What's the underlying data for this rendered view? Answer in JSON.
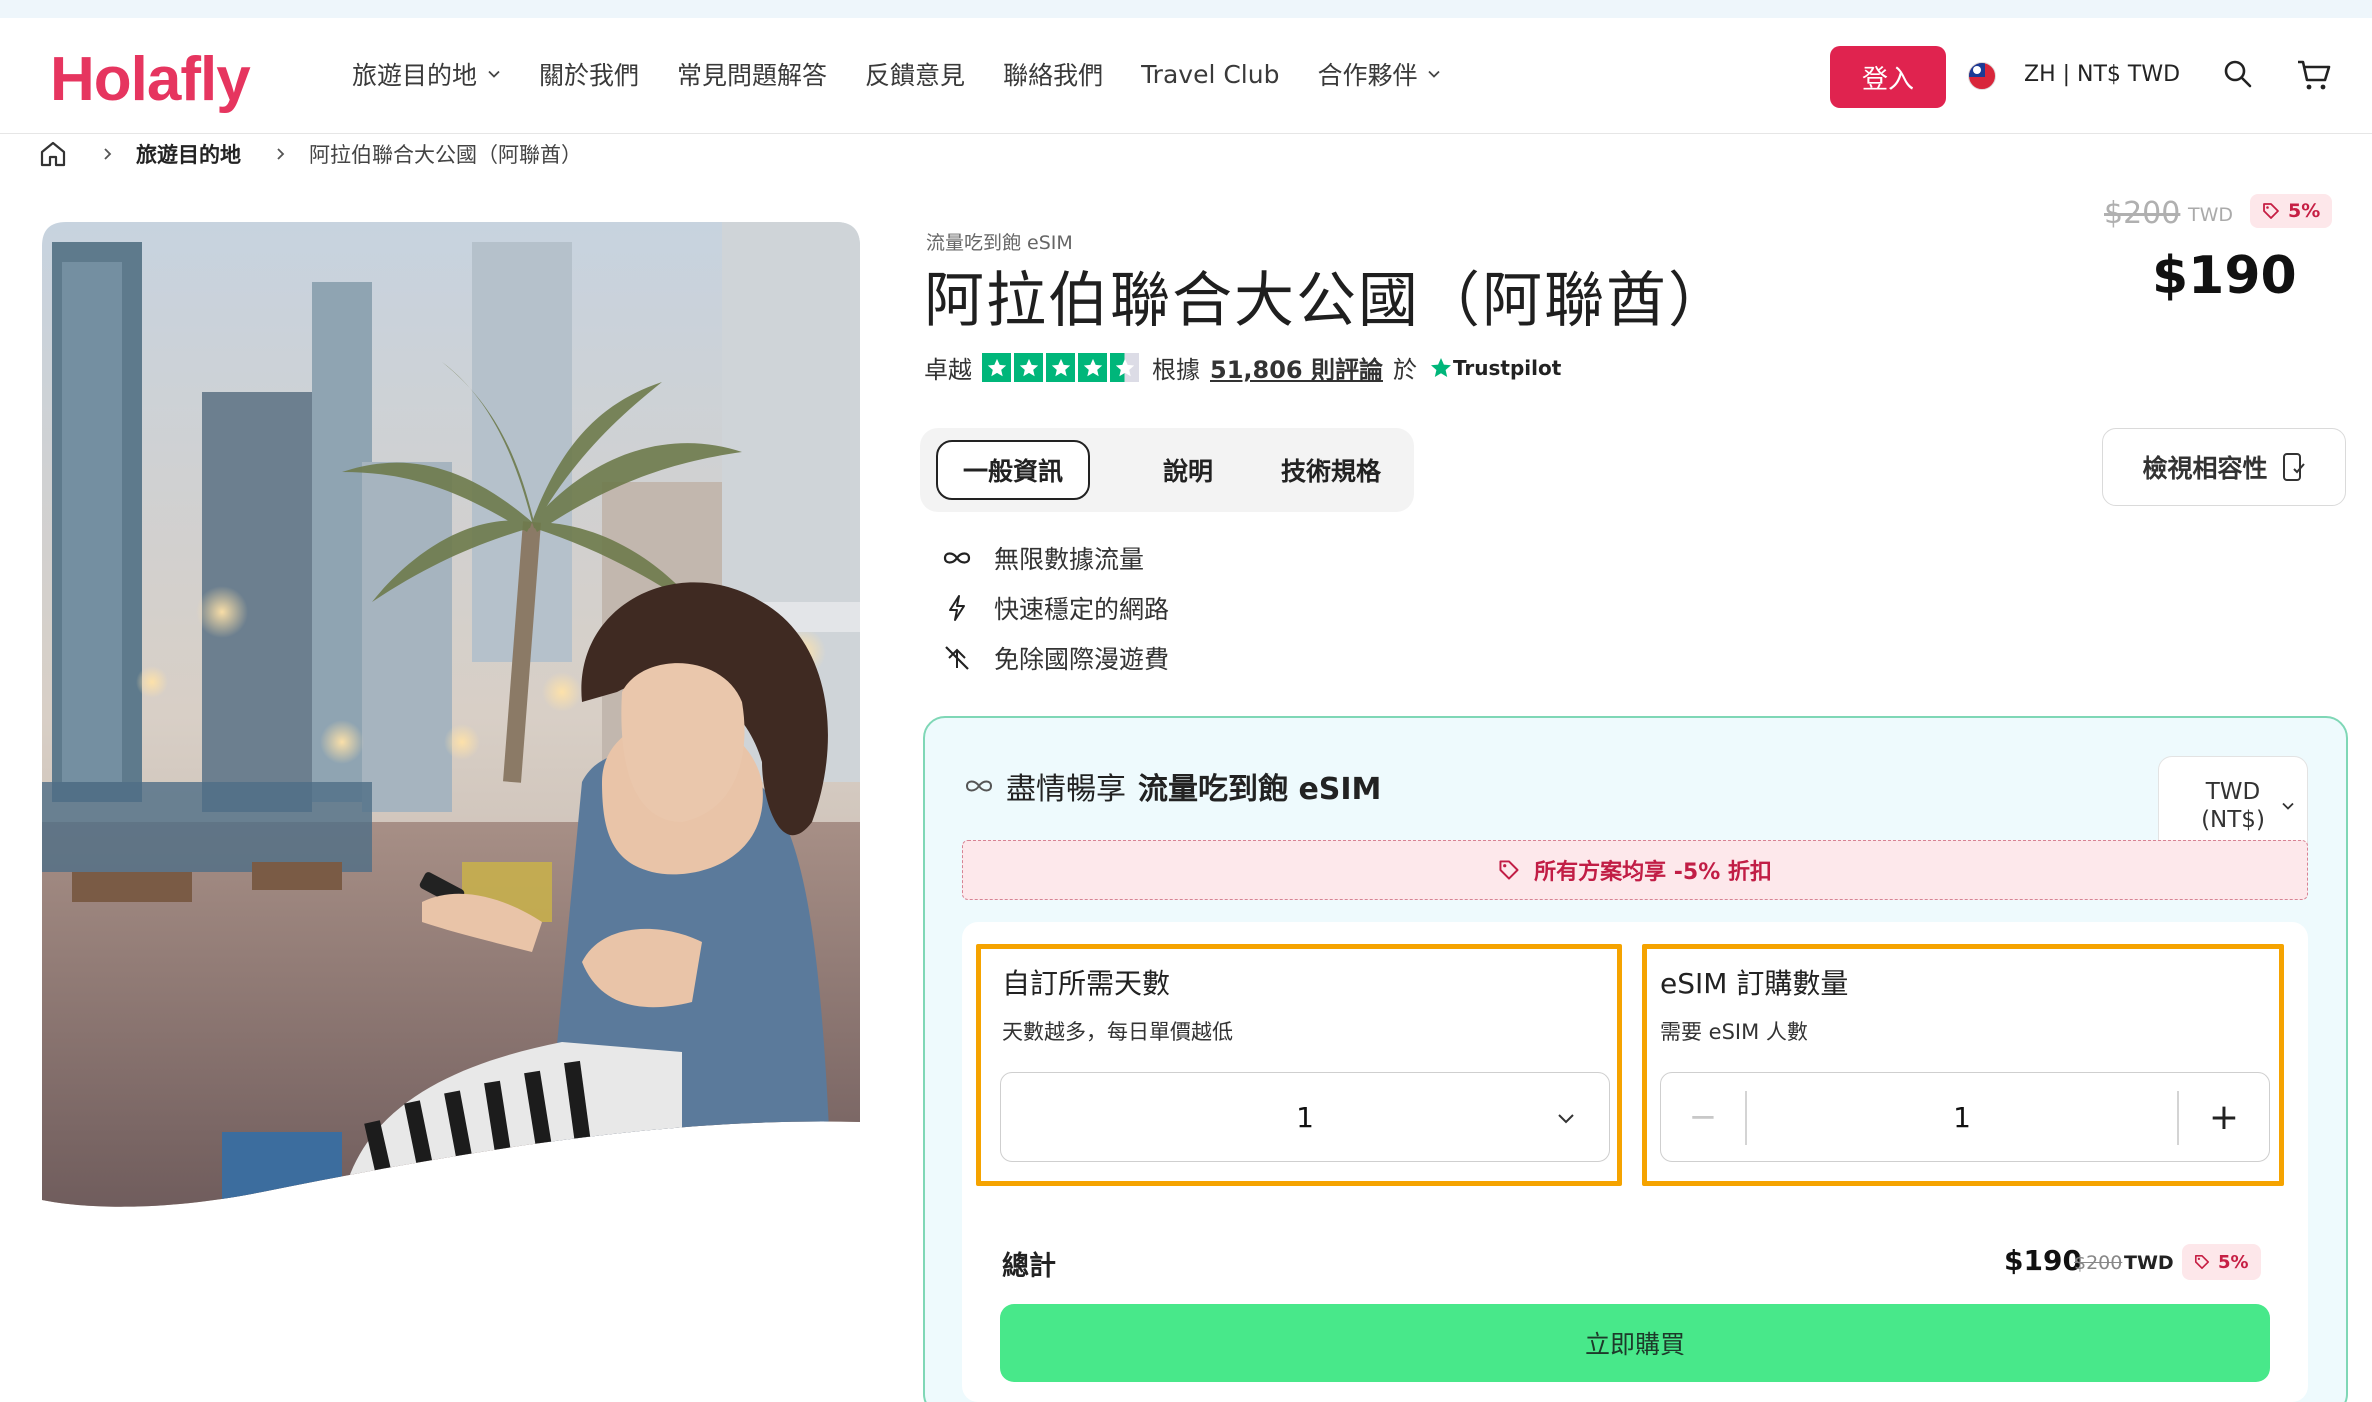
{
  "header": {
    "logo_text": "Holafly",
    "nav": [
      {
        "label": "旅遊目的地",
        "has_dropdown": true
      },
      {
        "label": "關於我們",
        "has_dropdown": false
      },
      {
        "label": "常見問題解答",
        "has_dropdown": false
      },
      {
        "label": "反饋意見",
        "has_dropdown": false
      },
      {
        "label": "聯絡我們",
        "has_dropdown": false
      },
      {
        "label": "Travel Club",
        "has_dropdown": false
      },
      {
        "label": "合作夥伴",
        "has_dropdown": true
      }
    ],
    "login_label": "登入",
    "locale_label": "ZH | NT$ TWD",
    "brand_color": "#e6355f",
    "login_color": "#e0234f"
  },
  "breadcrumb": {
    "items": [
      "旅遊目的地",
      "阿拉伯聯合大公國（阿聯酋）"
    ]
  },
  "product": {
    "subtitle": "流量吃到飽 eSIM",
    "title": "阿拉伯聯合大公國（阿聯酋）",
    "rating_word": "卓越",
    "rating_stars": 4.5,
    "based_on": "根據",
    "reviews_link": "51,806 則評論",
    "on_word": "於",
    "trustpilot": "Trustpilot",
    "old_price": "$200",
    "old_currency": "TWD",
    "discount": "5%",
    "price": "$190"
  },
  "tabs": [
    {
      "label": "一般資訊",
      "active": true
    },
    {
      "label": "說明",
      "active": false
    },
    {
      "label": "技術規格",
      "active": false
    }
  ],
  "compat_button": "檢視相容性",
  "features": [
    {
      "icon": "infinity-icon",
      "label": "無限數據流量"
    },
    {
      "icon": "lightning-icon",
      "label": "快速穩定的網路"
    },
    {
      "icon": "no-roaming-icon",
      "label": "免除國際漫遊費"
    }
  ],
  "plan": {
    "title_prefix": "盡情暢享",
    "title_bold": "流量吃到飽 eSIM",
    "currency_line1": "TWD",
    "currency_line2": "(NT$)",
    "discount_banner": "所有方案均享 -5% 折扣",
    "days_label": "自訂所需天數",
    "days_hint": "天數越多，每日單價越低",
    "days_value": "1",
    "qty_label": "eSIM 訂購數量",
    "qty_hint": "需要 eSIM 人數",
    "qty_value": "1",
    "total_label": "總計",
    "total_price": "$190",
    "total_old": "$200",
    "total_currency": "TWD",
    "total_discount": "5%",
    "buy_label": "立即購買",
    "card_border": "#7fd7b6",
    "highlight": "#f5a300",
    "buy_color": "#48e88a"
  }
}
